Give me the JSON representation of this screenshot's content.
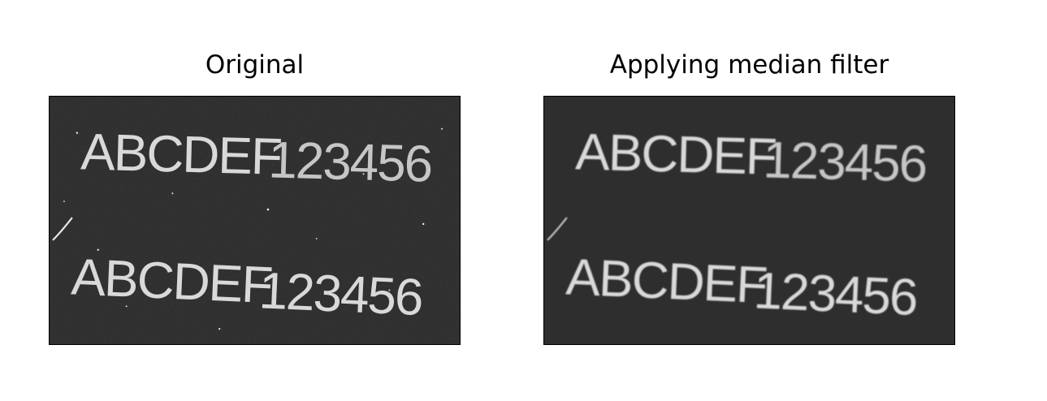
{
  "panels": [
    {
      "title": "Original",
      "lines": [
        "ABCDEF",
        "123456",
        "ABCDEF",
        "123456"
      ],
      "filtered": false
    },
    {
      "title": "Applying median filter",
      "lines": [
        "ABCDEF",
        "123456",
        "ABCDEF",
        "123456"
      ],
      "filtered": true
    }
  ],
  "colors": {
    "background": "#2e2e2e",
    "text": "#d9d9d9"
  }
}
